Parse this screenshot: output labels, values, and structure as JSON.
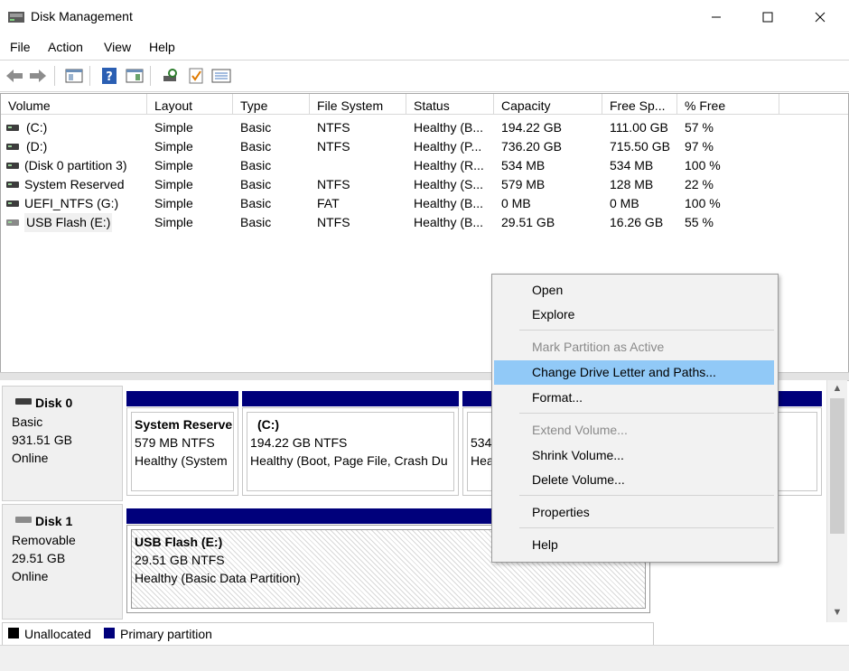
{
  "window": {
    "title": "Disk Management",
    "controls": {
      "minimize": "—",
      "maximize": "☐",
      "close": "✕"
    }
  },
  "menubar": [
    "File",
    "Action",
    "View",
    "Help"
  ],
  "toolbar": {
    "icons": [
      "back-arrow-icon",
      "forward-arrow-icon",
      "console-tree-icon",
      "help-icon",
      "show-pane-icon",
      "rescan-disks-icon",
      "properties-check-icon",
      "list-view-icon"
    ]
  },
  "volume_table": {
    "columns": [
      "Volume",
      "Layout",
      "Type",
      "File System",
      "Status",
      "Capacity",
      "Free Sp...",
      "% Free"
    ],
    "rows": [
      {
        "volume": "(C:)",
        "layout": "Simple",
        "type": "Basic",
        "fs": "NTFS",
        "status": "Healthy (B...",
        "capacity": "194.22 GB",
        "free": "111.00 GB",
        "pct": "57 %"
      },
      {
        "volume": "(D:)",
        "layout": "Simple",
        "type": "Basic",
        "fs": "NTFS",
        "status": "Healthy (P...",
        "capacity": "736.20 GB",
        "free": "715.50 GB",
        "pct": "97 %"
      },
      {
        "volume": "(Disk 0 partition 3)",
        "layout": "Simple",
        "type": "Basic",
        "fs": "",
        "status": "Healthy (R...",
        "capacity": "534 MB",
        "free": "534 MB",
        "pct": "100 %"
      },
      {
        "volume": "System Reserved",
        "layout": "Simple",
        "type": "Basic",
        "fs": "NTFS",
        "status": "Healthy (S...",
        "capacity": "579 MB",
        "free": "128 MB",
        "pct": "22 %"
      },
      {
        "volume": "UEFI_NTFS (G:)",
        "layout": "Simple",
        "type": "Basic",
        "fs": "FAT",
        "status": "Healthy (B...",
        "capacity": "0 MB",
        "free": "0 MB",
        "pct": "100 %"
      },
      {
        "volume": "USB Flash (E:)",
        "layout": "Simple",
        "type": "Basic",
        "fs": "NTFS",
        "status": "Healthy (B...",
        "capacity": "29.51 GB",
        "free": "16.26 GB",
        "pct": "55 %"
      }
    ]
  },
  "disks": [
    {
      "name": "Disk 0",
      "kind": "Basic",
      "size": "931.51 GB",
      "state": "Online",
      "partitions": [
        {
          "name": "System Reserve",
          "size_fs": "579 MB NTFS",
          "status": "Healthy (System"
        },
        {
          "name": "(C:)",
          "size_fs": "194.22 GB NTFS",
          "status": "Healthy (Boot, Page File, Crash Du"
        },
        {
          "name": "",
          "size_fs": "534",
          "status": "Hea"
        }
      ]
    },
    {
      "name": "Disk 1",
      "kind": "Removable",
      "size": "29.51 GB",
      "state": "Online",
      "partitions": [
        {
          "name": "USB Flash  (E:)",
          "size_fs": "29.51 GB NTFS",
          "status": "Healthy (Basic Data Partition)"
        }
      ]
    }
  ],
  "legend": [
    {
      "label": "Unallocated",
      "color": "#000000"
    },
    {
      "label": "Primary partition",
      "color": "#00007b"
    }
  ],
  "context_menu": {
    "items": [
      {
        "label": "Open",
        "enabled": true
      },
      {
        "label": "Explore",
        "enabled": true
      },
      {
        "label": "Mark Partition as Active",
        "enabled": false
      },
      {
        "label": "Change Drive Letter and Paths...",
        "enabled": true,
        "highlighted": true
      },
      {
        "label": "Format...",
        "enabled": true
      },
      {
        "label": "Extend Volume...",
        "enabled": false
      },
      {
        "label": "Shrink Volume...",
        "enabled": true
      },
      {
        "label": "Delete Volume...",
        "enabled": true
      },
      {
        "label": "Properties",
        "enabled": true
      },
      {
        "label": "Help",
        "enabled": true
      }
    ]
  },
  "colors": {
    "primary_partition": "#00007b",
    "menu_highlight": "#91c9f7"
  }
}
